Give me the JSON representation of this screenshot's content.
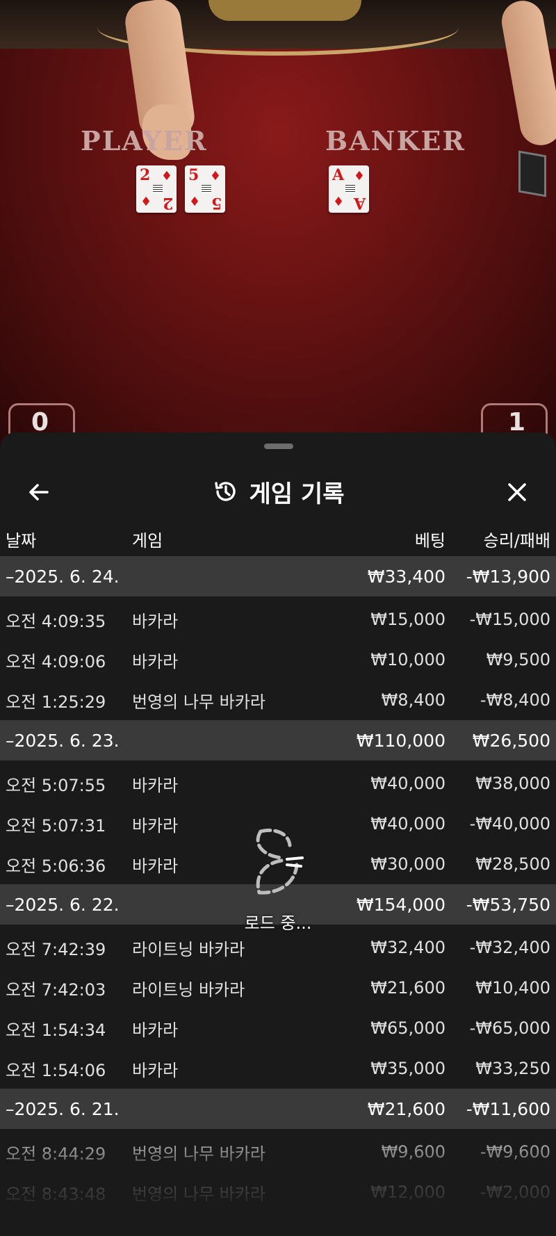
{
  "table": {
    "player_label": "PLAYER",
    "banker_label": "BANKER",
    "player_cards": [
      {
        "rank": "2",
        "suit": "♦"
      },
      {
        "rank": "5",
        "suit": "♦"
      }
    ],
    "banker_cards": [
      {
        "rank": "A",
        "suit": "♦"
      }
    ],
    "corner_left_value": "0",
    "corner_right_value": "1"
  },
  "sheet": {
    "title": "게임 기록",
    "back_icon": "arrow-left-icon",
    "history_icon": "history-icon",
    "close_icon": "close-icon"
  },
  "columns": {
    "date": "날짜",
    "game": "게임",
    "bet": "베팅",
    "win_loss": "승리/패배"
  },
  "groups": [
    {
      "date": "2025. 6. 24.",
      "bet_total": "₩33,400",
      "win_total": "-₩13,900",
      "rows": [
        {
          "time": "오전 4:09:35",
          "game": "바카라",
          "bet": "₩15,000",
          "win": "-₩15,000"
        },
        {
          "time": "오전 4:09:06",
          "game": "바카라",
          "bet": "₩10,000",
          "win": "₩9,500"
        },
        {
          "time": "오전 1:25:29",
          "game": "번영의 나무 바카라",
          "bet": "₩8,400",
          "win": "-₩8,400"
        }
      ]
    },
    {
      "date": "2025. 6. 23.",
      "bet_total": "₩110,000",
      "win_total": "₩26,500",
      "rows": [
        {
          "time": "오전 5:07:55",
          "game": "바카라",
          "bet": "₩40,000",
          "win": "₩38,000"
        },
        {
          "time": "오전 5:07:31",
          "game": "바카라",
          "bet": "₩40,000",
          "win": "-₩40,000"
        },
        {
          "time": "오전 5:06:36",
          "game": "바카라",
          "bet": "₩30,000",
          "win": "₩28,500"
        }
      ]
    },
    {
      "date": "2025. 6. 22.",
      "bet_total": "₩154,000",
      "win_total": "-₩53,750",
      "rows": [
        {
          "time": "오전 7:42:39",
          "game": "라이트닝 바카라",
          "bet": "₩32,400",
          "win": "-₩32,400"
        },
        {
          "time": "오전 7:42:03",
          "game": "라이트닝 바카라",
          "bet": "₩21,600",
          "win": "₩10,400"
        },
        {
          "time": "오전 1:54:34",
          "game": "바카라",
          "bet": "₩65,000",
          "win": "-₩65,000"
        },
        {
          "time": "오전 1:54:06",
          "game": "바카라",
          "bet": "₩35,000",
          "win": "₩33,250"
        }
      ]
    },
    {
      "date": "2025. 6. 21.",
      "bet_total": "₩21,600",
      "win_total": "-₩11,600",
      "rows": [
        {
          "time": "오전 8:44:29",
          "game": "번영의 나무 바카라",
          "bet": "₩9,600",
          "win": "-₩9,600"
        },
        {
          "time": "오전 8:43:48",
          "game": "번영의 나무 바카라",
          "bet": "₩12,000",
          "win": "-₩2,000"
        }
      ]
    }
  ],
  "loader": {
    "text": "로드 중..."
  }
}
